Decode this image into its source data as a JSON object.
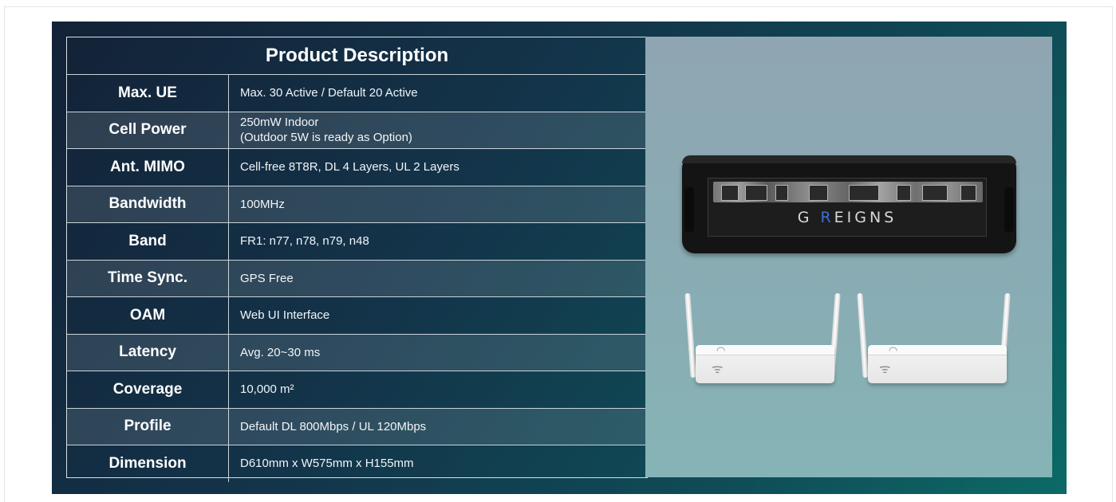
{
  "table": {
    "title": "Product Description",
    "rows": [
      {
        "label": "Max. UE",
        "value": "Max. 30 Active / Default 20 Active",
        "value2": ""
      },
      {
        "label": "Cell Power",
        "value": "250mW Indoor",
        "value2": "(Outdoor 5W is ready as Option)"
      },
      {
        "label": "Ant. MIMO",
        "value": "Cell-free 8T8R, DL 4 Layers, UL 2 Layers",
        "value2": ""
      },
      {
        "label": "Bandwidth",
        "value": "100MHz",
        "value2": ""
      },
      {
        "label": "Band",
        "value": "FR1: n77, n78, n79, n48",
        "value2": ""
      },
      {
        "label": "Time Sync.",
        "value": "GPS Free",
        "value2": ""
      },
      {
        "label": "OAM",
        "value": "Web UI Interface",
        "value2": ""
      },
      {
        "label": "Latency",
        "value": "Avg. 20~30 ms",
        "value2": ""
      },
      {
        "label": "Coverage",
        "value": "10,000 m²",
        "value2": ""
      },
      {
        "label": "Profile",
        "value": "Default DL 800Mbps / UL 120Mbps",
        "value2": ""
      },
      {
        "label": "Dimension",
        "value": "D610mm x W575mm x H155mm",
        "value2": ""
      }
    ]
  },
  "product_image": {
    "brand_prefix": "G ",
    "brand_accent": "R",
    "brand_suffix": "EIGNS"
  },
  "colors": {
    "panel_dark": "#132237",
    "panel_teal": "#0c6a66",
    "brand_accent": "#3d6fd6"
  }
}
